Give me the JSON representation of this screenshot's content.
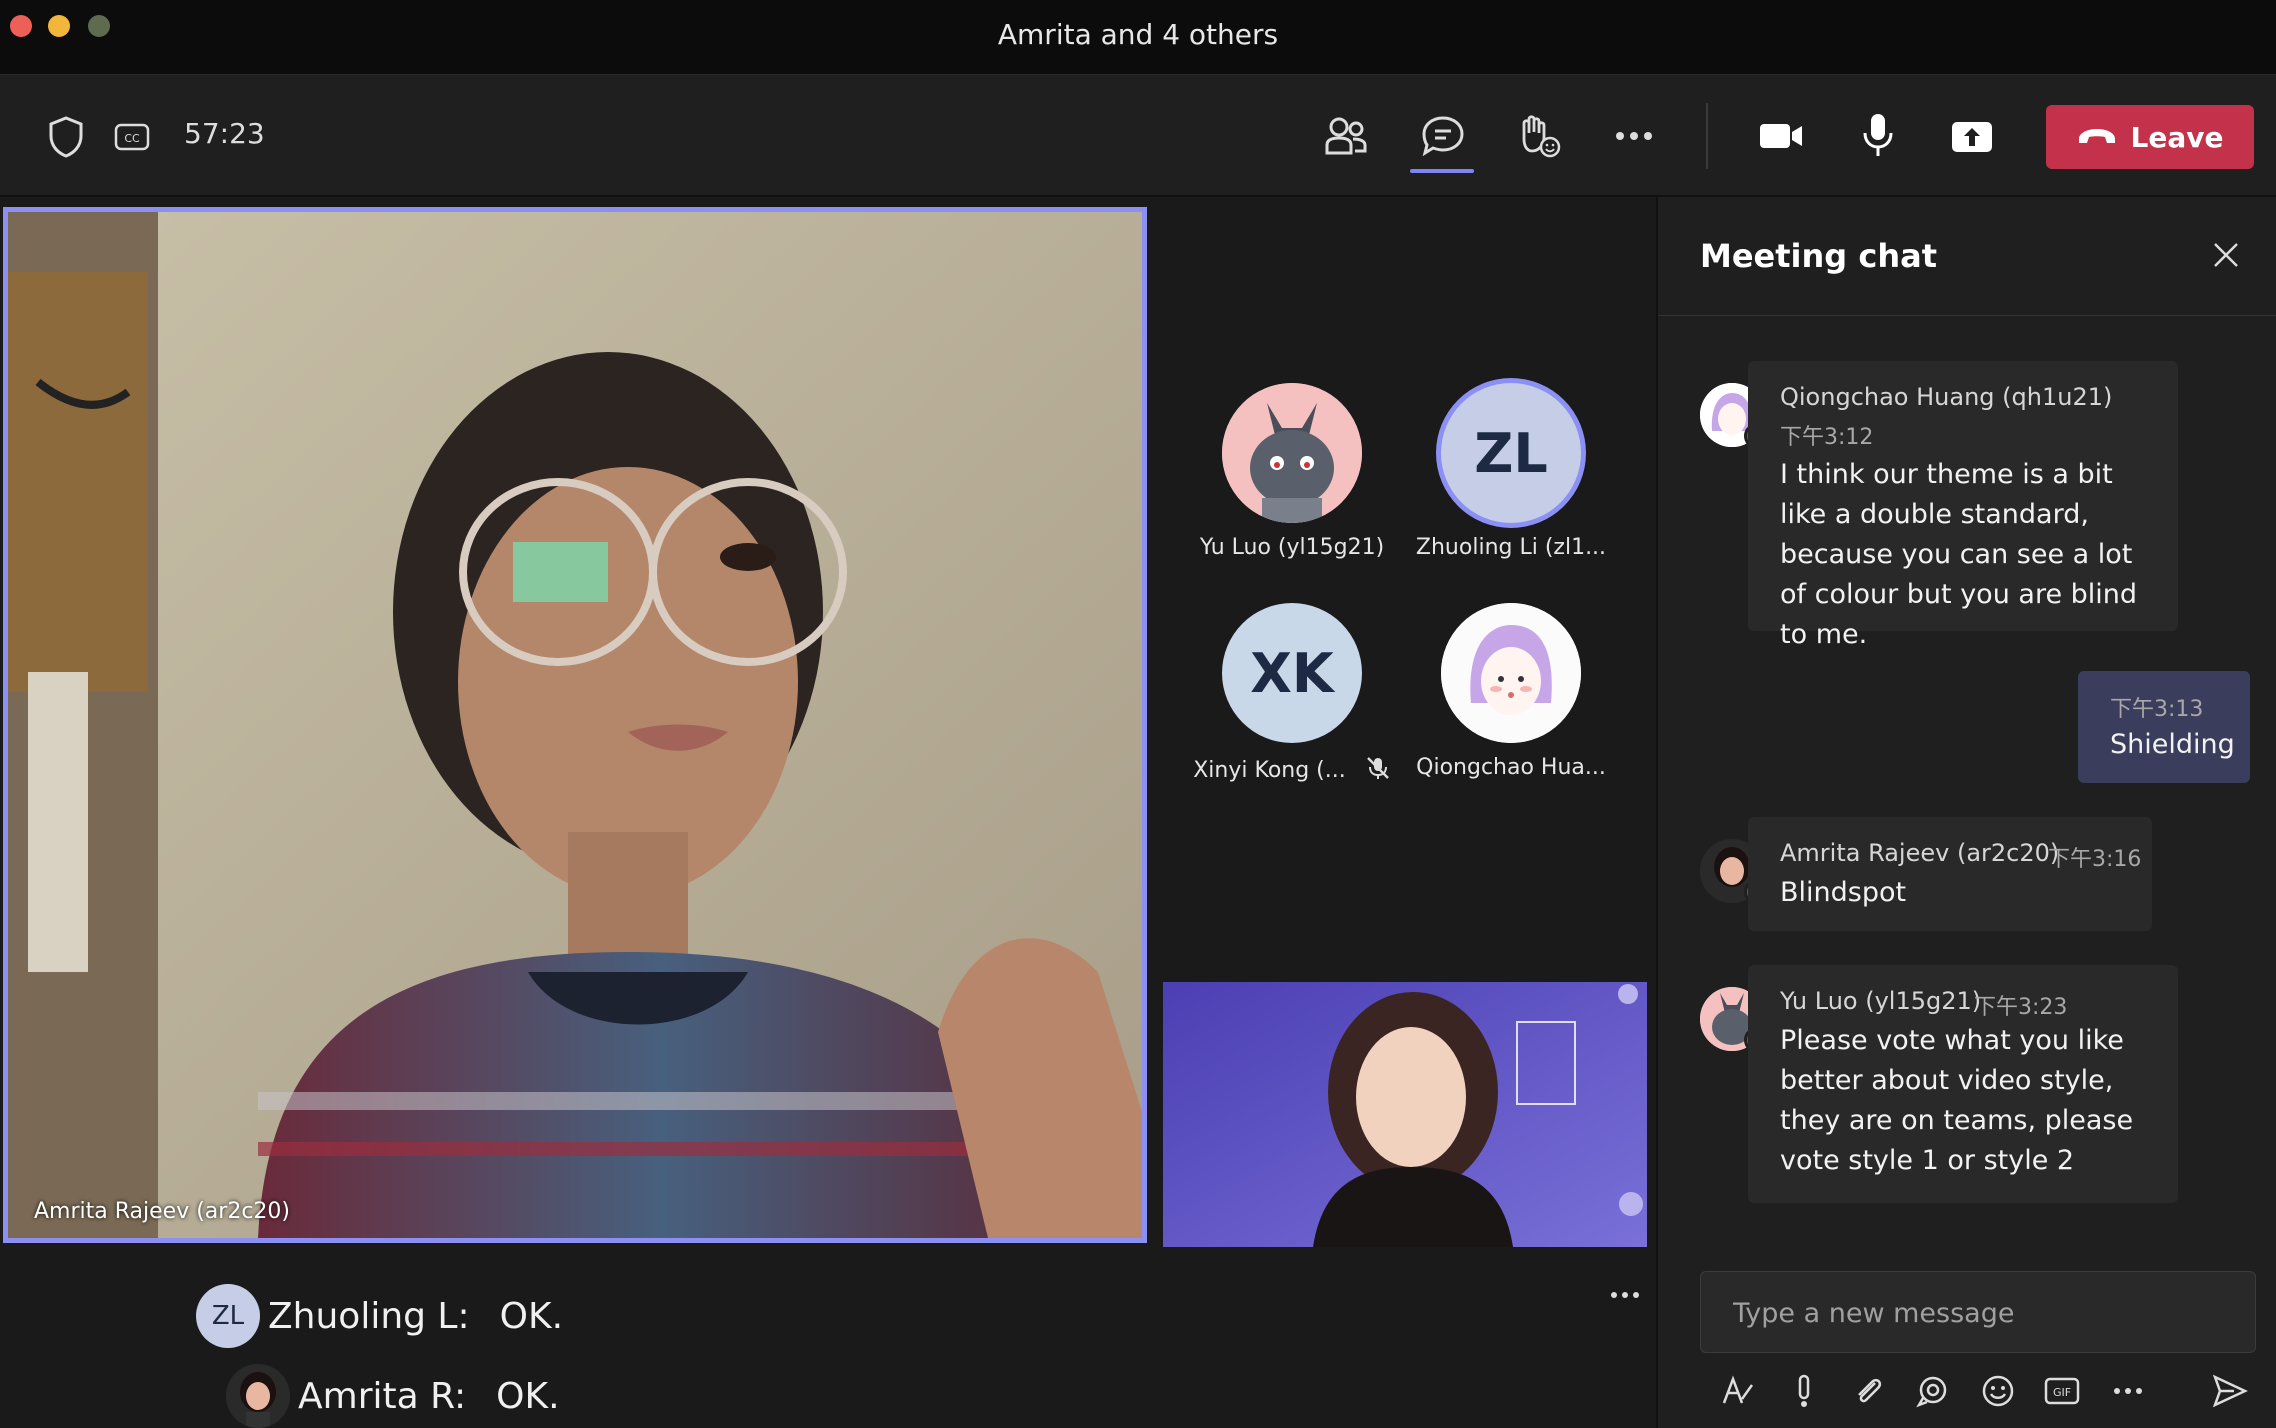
{
  "window": {
    "title": "Amrita and 4 others"
  },
  "toolbar": {
    "timer": "57:23",
    "leave_label": "Leave",
    "icons": [
      "shield-icon",
      "closed-captions-icon",
      "people-icon",
      "chat-icon",
      "raise-hand-icon",
      "more-icon",
      "camera-icon",
      "microphone-icon",
      "share-icon"
    ]
  },
  "stage": {
    "main_participant": "Amrita Rajeev (ar2c20)",
    "tiles": [
      {
        "label": "Yu Luo (yl15g21)",
        "initials": ""
      },
      {
        "label": "Zhuoling Li (zl1...",
        "initials": "ZL"
      },
      {
        "label": "Xinyi Kong (...",
        "initials": "XK"
      },
      {
        "label": "Qiongchao Hua...",
        "initials": ""
      }
    ],
    "captions": [
      {
        "initials": "ZL",
        "speaker": "Zhuoling L:",
        "text": "OK."
      },
      {
        "initials": "",
        "speaker": "Amrita R:",
        "text": "OK."
      }
    ]
  },
  "chat": {
    "title": "Meeting chat",
    "messages": [
      {
        "sender": "Qiongchao Huang (qh1u21)",
        "time": "下午3:12",
        "text": "I think our theme is a bit like a double standard, because you can see a lot of colour but you are blind to me."
      },
      {
        "mine": true,
        "time": "下午3:13",
        "text": "Shielding"
      },
      {
        "sender": "Amrita Rajeev (ar2c20)",
        "time": "下午3:16",
        "text": "Blindspot"
      },
      {
        "sender": "Yu Luo (yl15g21)",
        "time": "下午3:23",
        "text": "Please vote what you like better about video style, they are on teams, please vote style 1 or style 2"
      }
    ],
    "compose_placeholder": "Type a new message",
    "compose_icons": [
      "format-icon",
      "important-icon",
      "attach-icon",
      "loop-icon",
      "emoji-icon",
      "gif-icon",
      "more-options-icon",
      "send-icon"
    ]
  },
  "colors": {
    "leave": "#c4314b",
    "accent": "#7f85f5",
    "presence_busy": "#c4314b"
  }
}
